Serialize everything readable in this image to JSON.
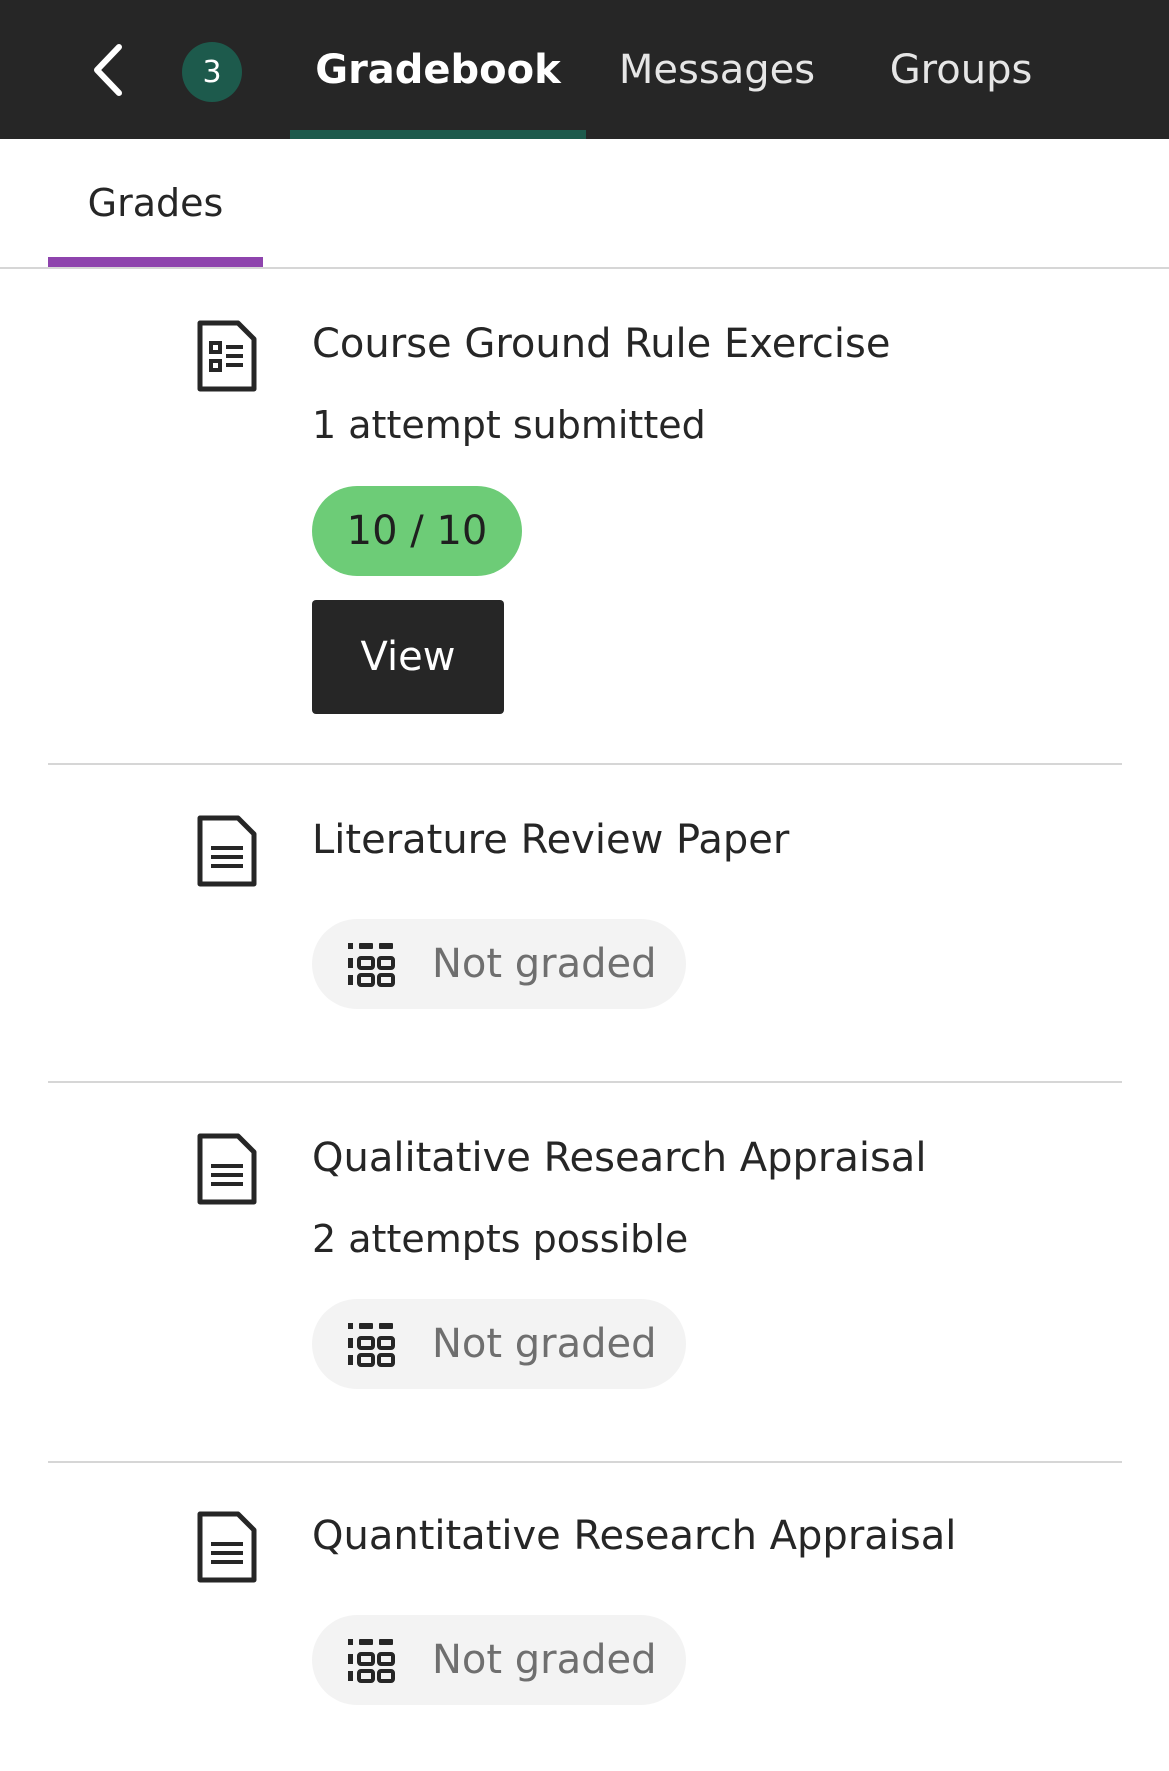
{
  "header": {
    "badge_count": "3",
    "tabs": [
      {
        "label": "Gradebook",
        "active": true
      },
      {
        "label": "Messages",
        "active": false
      },
      {
        "label": "Groups",
        "active": false
      }
    ],
    "icons": {
      "back": "chevron-left-icon"
    }
  },
  "subtabs": {
    "grades": "Grades"
  },
  "grades": [
    {
      "title": "Course Ground Rule Exercise",
      "subtitle": "1 attempt submitted",
      "score": "10 / 10",
      "action": "View",
      "icon": "document-list-icon"
    },
    {
      "title": "Literature Review Paper",
      "status": "Not graded",
      "icon": "document-icon"
    },
    {
      "title": "Qualitative Research Appraisal",
      "subtitle": "2 attempts possible",
      "status": "Not graded",
      "icon": "document-icon"
    },
    {
      "title": "Quantitative Research Appraisal",
      "status": "Not graded",
      "icon": "document-icon"
    }
  ],
  "colors": {
    "header_bg": "#262626",
    "accent_green": "#1d5a4c",
    "subtab_accent": "#8e44ad",
    "score_pill": "#6dcc77",
    "not_graded_pill": "#f3f3f3"
  }
}
